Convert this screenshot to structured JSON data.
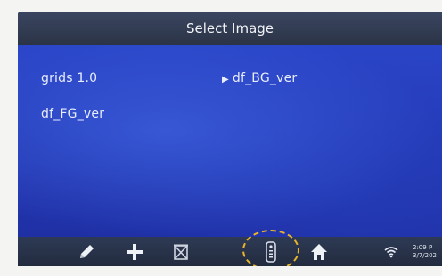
{
  "header": {
    "title": "Select Image"
  },
  "image_list": [
    {
      "label": "grids 1.0",
      "selected": false
    },
    {
      "label": "df_BG_ver",
      "selected": true,
      "marker": "▶"
    },
    {
      "label": "df_FG_ver",
      "selected": false
    }
  ],
  "toolbar": {
    "icons": [
      "pencil-icon",
      "plus-icon",
      "delete-box-icon",
      "remote-control-icon",
      "home-icon",
      "wifi-icon"
    ],
    "highlighted_icon": "remote-control-icon"
  },
  "status": {
    "time": "2:09 P",
    "date": "3/7/202"
  },
  "colors": {
    "screen_blue": "#1e2f9a",
    "titlebar": "#323d55",
    "highlight_circle": "#e8b52a"
  }
}
